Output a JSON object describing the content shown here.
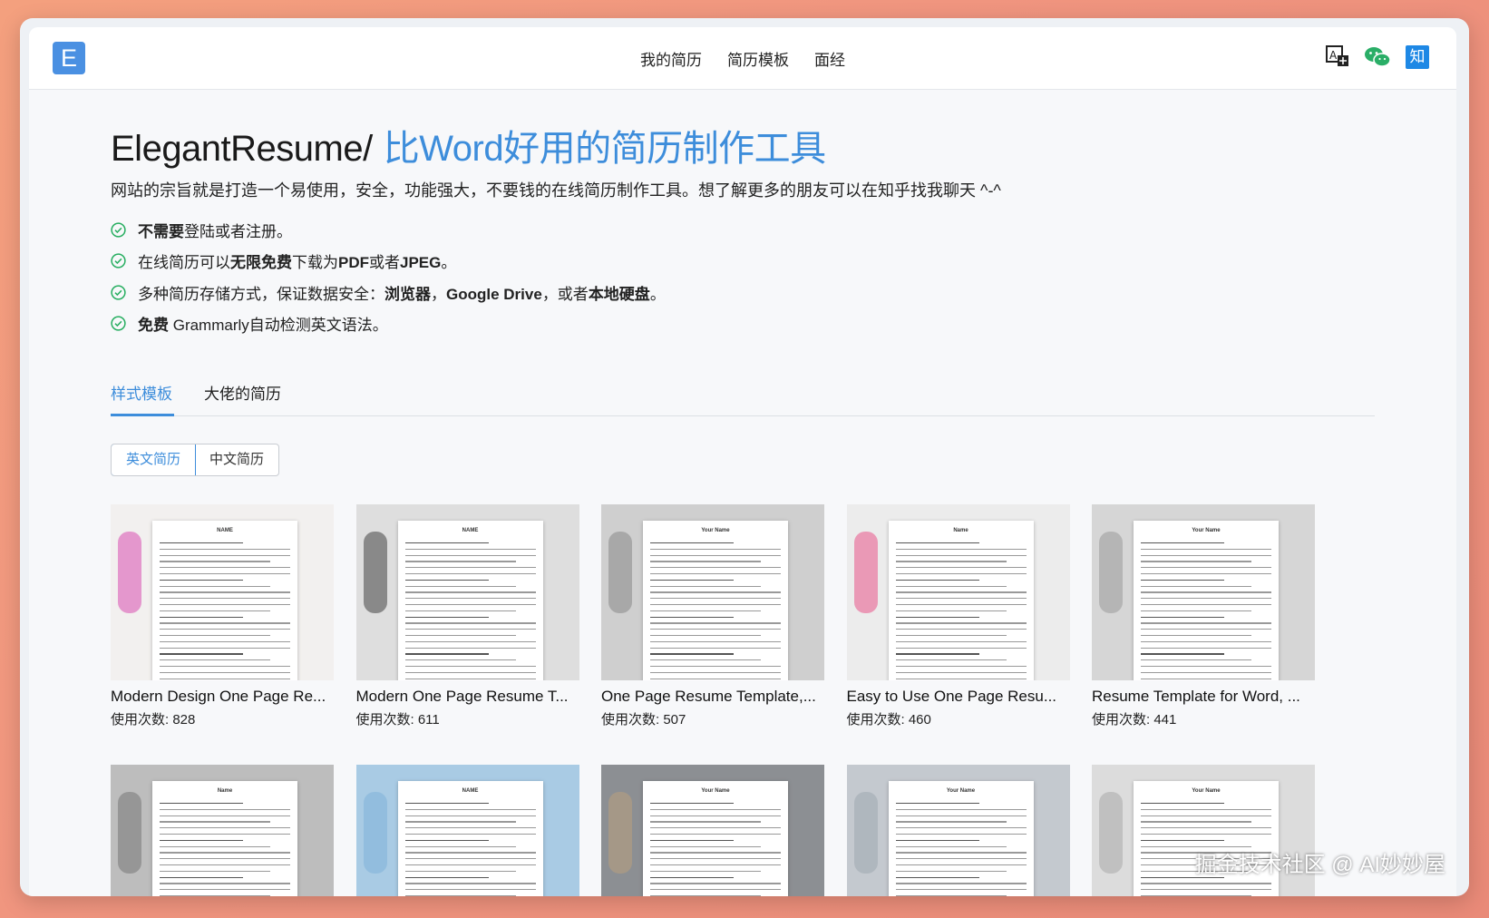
{
  "header": {
    "logo_letter": "E",
    "nav": [
      "我的简历",
      "简历模板",
      "面经"
    ],
    "zhihu_label": "知"
  },
  "hero": {
    "title_main": "ElegantResume/",
    "title_accent": "比Word好用的简历制作工具",
    "subtitle": "网站的宗旨就是打造一个易使用，安全，功能强大，不要钱的在线简历制作工具。想了解更多的朋友可以在知乎找我聊天 ^-^"
  },
  "features": [
    [
      {
        "t": "不需要",
        "b": true
      },
      {
        "t": "登陆或者注册。",
        "b": false
      }
    ],
    [
      {
        "t": "在线简历可以",
        "b": false
      },
      {
        "t": "无限免费",
        "b": true
      },
      {
        "t": "下载为",
        "b": false
      },
      {
        "t": "PDF",
        "b": true
      },
      {
        "t": "或者",
        "b": false
      },
      {
        "t": "JPEG",
        "b": true
      },
      {
        "t": "。",
        "b": false
      }
    ],
    [
      {
        "t": "多种简历存储方式，保证数据安全：",
        "b": false
      },
      {
        "t": "浏览器",
        "b": true
      },
      {
        "t": "，",
        "b": false
      },
      {
        "t": "Google Drive",
        "b": true
      },
      {
        "t": "，或者",
        "b": false
      },
      {
        "t": "本地硬盘",
        "b": true
      },
      {
        "t": "。",
        "b": false
      }
    ],
    [
      {
        "t": "免费",
        "b": true
      },
      {
        "t": " Grammarly自动检测英文语法。",
        "b": false
      }
    ]
  ],
  "tabs": [
    "样式模板",
    "大佬的简历"
  ],
  "segment": [
    "英文简历",
    "中文简历"
  ],
  "uses_prefix": "使用次数: ",
  "templates": [
    {
      "name": "Modern Design One Page Re...",
      "uses": 828,
      "paper_title": "NAME",
      "bg": "#f2f0ef",
      "accent": "#d94fb0"
    },
    {
      "name": "Modern One Page Resume T...",
      "uses": 611,
      "paper_title": "NAME",
      "bg": "#dedede",
      "accent": "#444444"
    },
    {
      "name": "One Page Resume Template,...",
      "uses": 507,
      "paper_title": "Your Name",
      "bg": "#cfcfcf",
      "accent": "#888888"
    },
    {
      "name": "Easy to Use One Page Resu...",
      "uses": 460,
      "paper_title": "Name",
      "bg": "#ececec",
      "accent": "#e9558a"
    },
    {
      "name": "Resume Template for Word, ...",
      "uses": 441,
      "paper_title": "Your Name",
      "bg": "#d6d6d6",
      "accent": "#9a9a9a"
    },
    {
      "name": "",
      "uses": null,
      "paper_title": "Name",
      "bg": "#bdbdbd",
      "accent": "#777777"
    },
    {
      "name": "",
      "uses": null,
      "paper_title": "NAME",
      "bg": "#a9cbe4",
      "accent": "#7fb2d8"
    },
    {
      "name": "",
      "uses": null,
      "paper_title": "Your Name",
      "bg": "#8c8f93",
      "accent": "#b9a17e"
    },
    {
      "name": "",
      "uses": null,
      "paper_title": "Your Name",
      "bg": "#c4c9cf",
      "accent": "#9fa7b0"
    },
    {
      "name": "",
      "uses": null,
      "paper_title": "Your Name",
      "bg": "#dcdcdc",
      "accent": "#aaaaaa"
    }
  ],
  "watermark": "掘金技术社区 @ AI妙妙屋",
  "colors": {
    "accent": "#3d8ddb",
    "check": "#27ae60",
    "logo": "#4a90e2"
  }
}
